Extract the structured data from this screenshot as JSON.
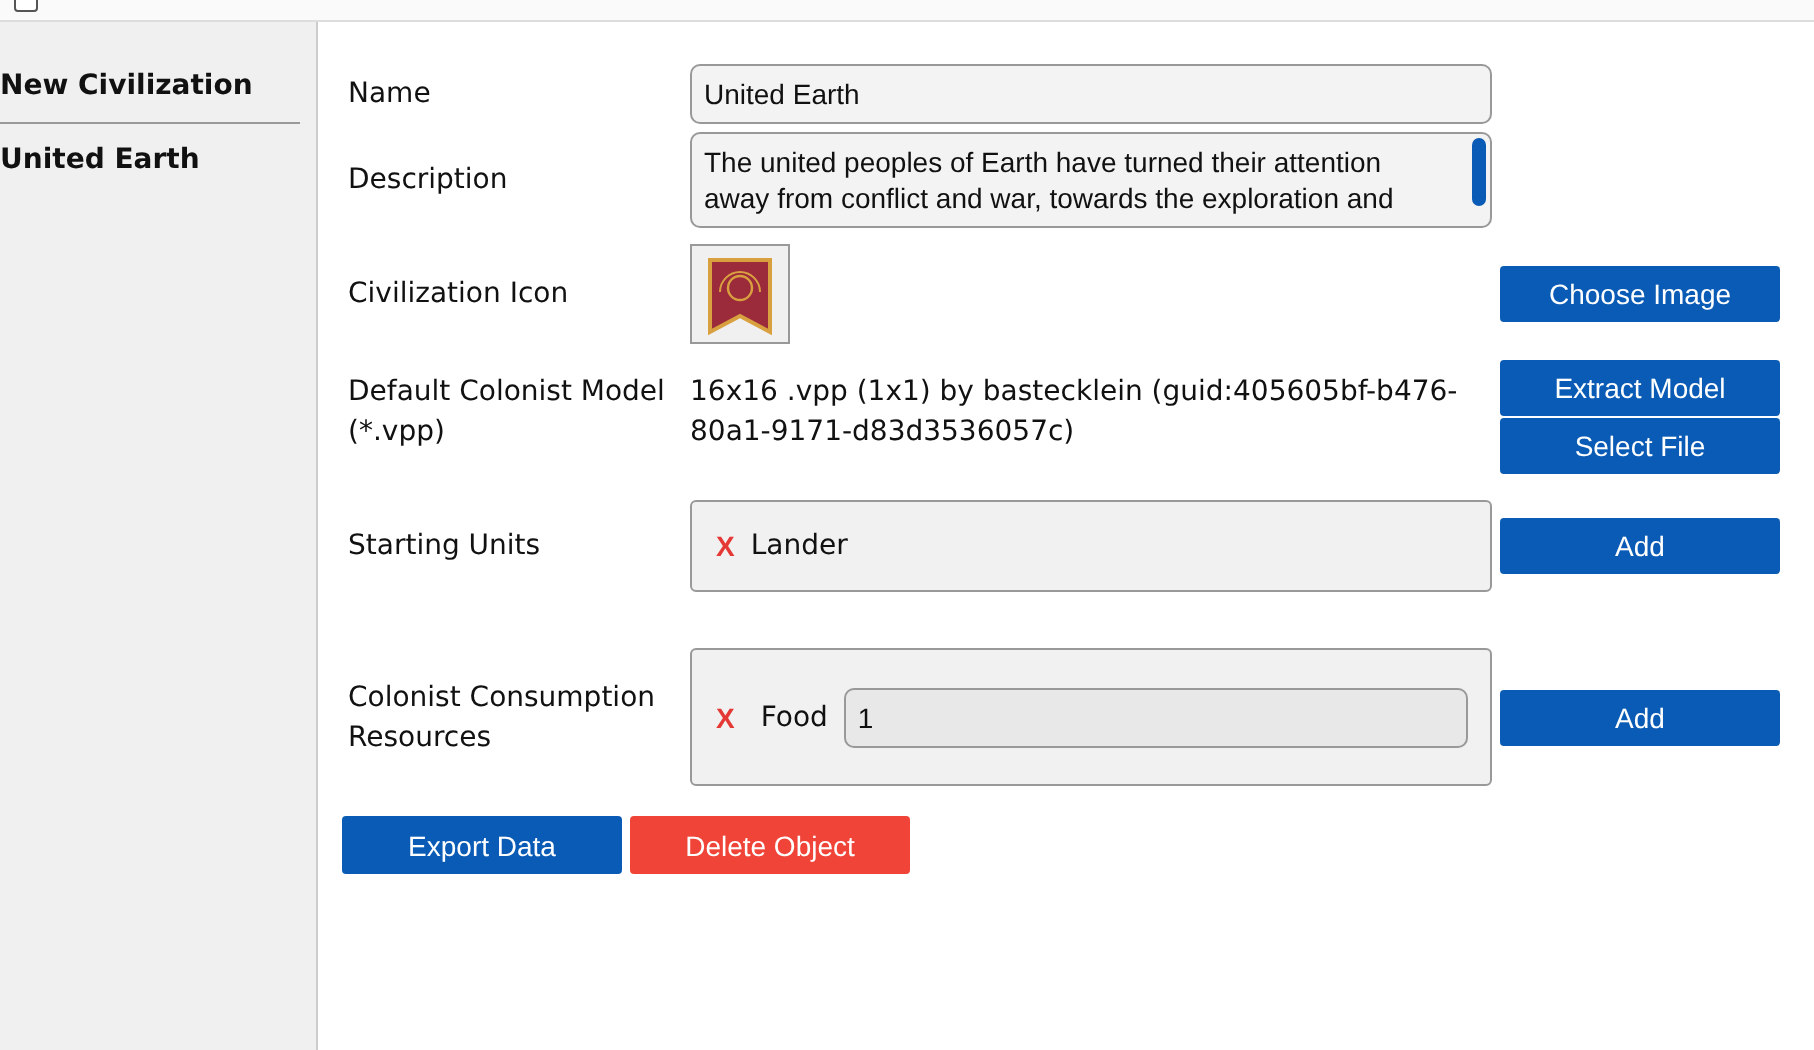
{
  "browser": {
    "checkbox": {
      "checked": false
    }
  },
  "sidebar": {
    "items": [
      {
        "label": "New Civilization"
      },
      {
        "label": "United Earth"
      }
    ]
  },
  "form": {
    "name": {
      "label": "Name",
      "value": "United Earth"
    },
    "description": {
      "label": "Description",
      "value": "The united peoples of Earth have turned their attention away from conflict and war, towards the exploration and"
    },
    "icon": {
      "label": "Civilization Icon",
      "button": "Choose Image"
    },
    "model": {
      "label": "Default Colonist Model  (*.vpp)",
      "value": "16x16 .vpp (1x1) by bastecklein (guid:405605bf-b476-80a1-9171-d83d3536057c)",
      "buttons": [
        "Extract Model",
        "Select File"
      ]
    },
    "starting_units": {
      "label": "Starting Units",
      "items": [
        {
          "remove": "X",
          "name": "Lander"
        }
      ],
      "button": "Add"
    },
    "consumption": {
      "label": "Colonist Consumption Resources",
      "items": [
        {
          "remove": "X",
          "name": "Food",
          "amount": "1"
        }
      ],
      "button": "Add"
    }
  },
  "actions": [
    {
      "label": "Export Data",
      "kind": "primary"
    },
    {
      "label": "Delete Object",
      "kind": "danger"
    }
  ]
}
